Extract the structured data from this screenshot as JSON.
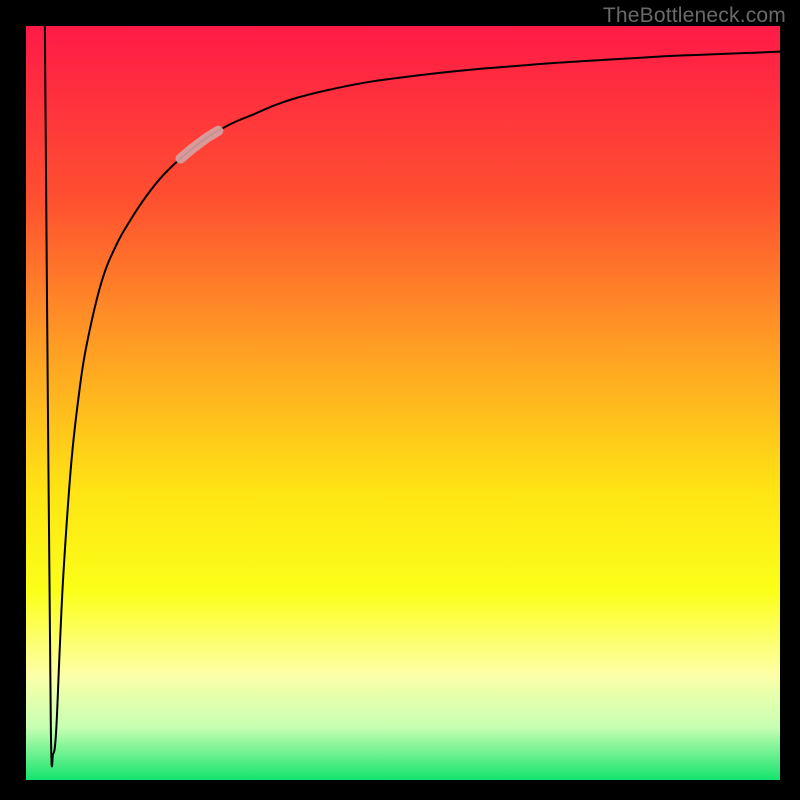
{
  "watermark": "TheBottleneck.com",
  "chart_data": {
    "type": "line",
    "title": "",
    "xlabel": "",
    "ylabel": "",
    "xlim": [
      0,
      100
    ],
    "ylim": [
      0,
      100
    ],
    "background_gradient": {
      "stops": [
        {
          "offset": 0.0,
          "color": "#ff1a47"
        },
        {
          "offset": 0.23,
          "color": "#ff5030"
        },
        {
          "offset": 0.45,
          "color": "#ffa722"
        },
        {
          "offset": 0.62,
          "color": "#ffe514"
        },
        {
          "offset": 0.75,
          "color": "#fbff19"
        },
        {
          "offset": 0.86,
          "color": "#fdffa7"
        },
        {
          "offset": 0.93,
          "color": "#c7ffb3"
        },
        {
          "offset": 1.0,
          "color": "#14e36d"
        }
      ]
    },
    "curve_color": "#000000",
    "curve_width": 2.0,
    "highlight_segment": {
      "x_start": 20.5,
      "x_end": 25.5,
      "color": "#d6a4a4",
      "opacity": 0.9,
      "width": 10
    },
    "series": [
      {
        "name": "bottleneck-curve",
        "x": [
          2.5,
          2.9,
          3.3,
          3.6,
          4.0,
          4.5,
          5.0,
          6.0,
          7.0,
          8.0,
          10.0,
          12.0,
          14.0,
          16.0,
          18.0,
          20.0,
          22.0,
          24.0,
          26.0,
          28.0,
          30.0,
          33.0,
          36.0,
          40.0,
          45.0,
          50.0,
          55.0,
          60.0,
          65.0,
          70.0,
          75.0,
          80.0,
          85.0,
          90.0,
          95.0,
          100.0
        ],
        "values": [
          100.0,
          50.0,
          6.5,
          3.5,
          6.5,
          18.0,
          28.0,
          42.0,
          51.0,
          57.5,
          66.0,
          71.0,
          74.5,
          77.5,
          80.0,
          82.0,
          83.7,
          85.2,
          86.4,
          87.4,
          88.2,
          89.5,
          90.5,
          91.5,
          92.5,
          93.2,
          93.8,
          94.3,
          94.7,
          95.1,
          95.4,
          95.7,
          96.0,
          96.2,
          96.4,
          96.6
        ]
      }
    ]
  }
}
